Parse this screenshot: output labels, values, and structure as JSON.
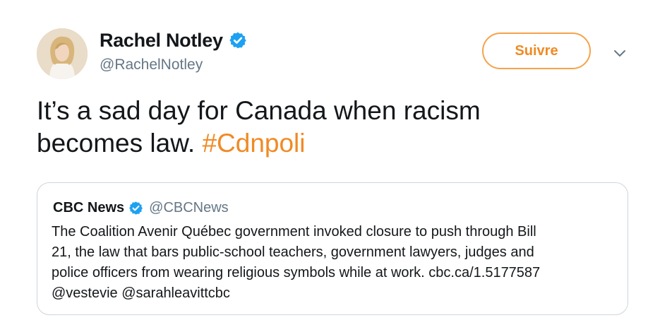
{
  "author": {
    "display_name": "Rachel Notley",
    "handle": "@RachelNotley",
    "verified": true
  },
  "follow_button": {
    "label": "Suivre"
  },
  "tweet": {
    "text_line1": "It’s a sad day for Canada when racism",
    "text_line2_plain": "becomes law.",
    "hashtag": "#Cdnpoli"
  },
  "quoted_tweet": {
    "display_name": "CBC News",
    "handle": "@CBCNews",
    "verified": true,
    "lines": [
      "The Coalition Avenir Québec government invoked closure to push through Bill",
      "21, the law that bars public-school teachers, government lawyers, judges and",
      "police officers from wearing religious symbols while at work. cbc.ca/1.5177587",
      "@vestevie @sarahleavittcbc"
    ]
  },
  "colors": {
    "accent": "#f08a24",
    "verified_blue": "#1da1f2",
    "text": "#14171a",
    "secondary_text": "#657786",
    "border": "#ccd6dd"
  },
  "icons": {
    "verified": "verified-badge-icon",
    "more": "chevron-down-icon"
  }
}
